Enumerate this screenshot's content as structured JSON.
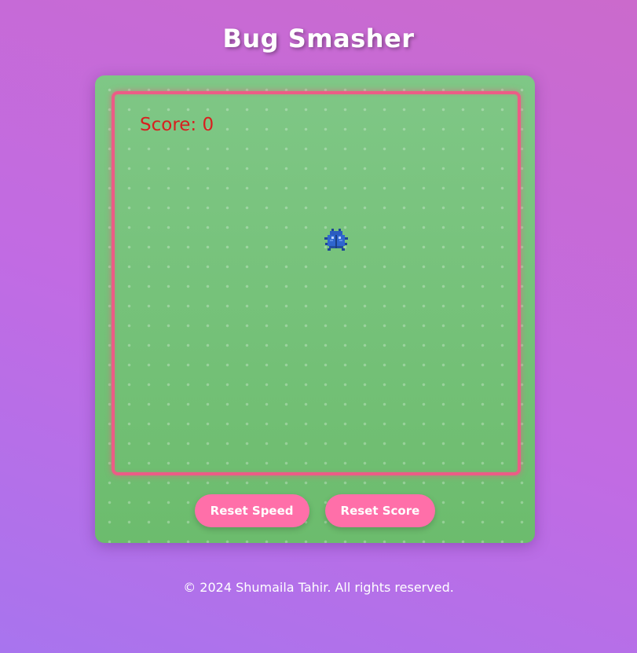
{
  "app": {
    "title": "Bug Smasher"
  },
  "game": {
    "score_label": "Score: 0",
    "score": 0,
    "bug_icon": "bug-sprite-icon"
  },
  "controls": {
    "reset_speed_label": "Reset Speed",
    "reset_score_label": "Reset Score"
  },
  "footer": {
    "text": "© 2024 Shumaila Tahir. All rights reserved."
  },
  "colors": {
    "background_start": "#a874ee",
    "background_end": "#cb6acc",
    "board_green": "#73c173",
    "arena_border": "#ec5c86",
    "score_red": "#d81f1f",
    "button_pink": "#ff6fa9",
    "bug_blue": "#2b5cc0"
  }
}
